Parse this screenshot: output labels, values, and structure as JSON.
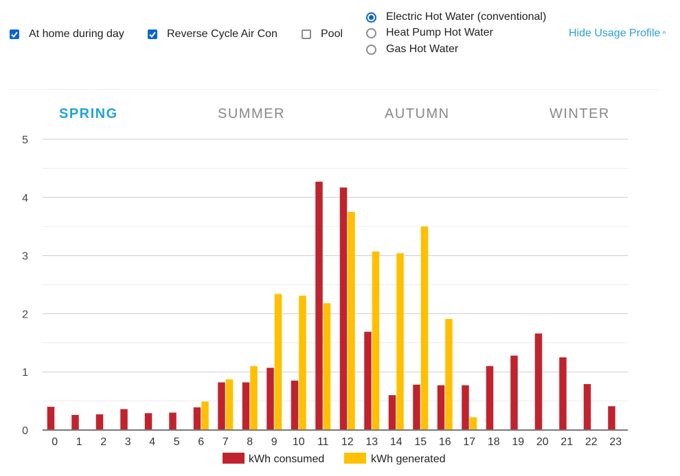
{
  "options": {
    "checkboxes": [
      {
        "label": "At home during day",
        "checked": true
      },
      {
        "label": "Reverse Cycle Air Con",
        "checked": true
      },
      {
        "label": "Pool",
        "checked": false
      }
    ],
    "hot_water": [
      {
        "label": "Electric Hot Water (conventional)",
        "selected": true
      },
      {
        "label": "Heat Pump Hot Water",
        "selected": false
      },
      {
        "label": "Gas Hot Water",
        "selected": false
      }
    ],
    "hide_link": "Hide Usage Profile",
    "hide_caret": "^"
  },
  "tabs": [
    {
      "label": "SPRING",
      "active": true
    },
    {
      "label": "SUMMER",
      "active": false
    },
    {
      "label": "AUTUMN",
      "active": false
    },
    {
      "label": "WINTER",
      "active": false
    }
  ],
  "colors": {
    "consumed": "#c1232e",
    "generated": "#ffc000",
    "accent": "#21a3d9",
    "checkbox": "#0b63d6"
  },
  "chart_data": {
    "type": "bar",
    "title": "",
    "xlabel": "",
    "ylabel": "",
    "ylim": [
      0,
      5
    ],
    "yticks": [
      0,
      1,
      2,
      3,
      4,
      5
    ],
    "grid": true,
    "legend": "bottom",
    "categories": [
      "0",
      "1",
      "2",
      "3",
      "4",
      "5",
      "6",
      "7",
      "8",
      "9",
      "10",
      "11",
      "12",
      "13",
      "14",
      "15",
      "16",
      "17",
      "18",
      "19",
      "20",
      "21",
      "22",
      "23"
    ],
    "series": [
      {
        "name": "kWh consumed",
        "values": [
          0.4,
          0.26,
          0.27,
          0.36,
          0.29,
          0.3,
          0.39,
          0.82,
          0.82,
          1.07,
          0.85,
          4.27,
          4.17,
          1.69,
          0.6,
          0.78,
          0.77,
          0.77,
          1.1,
          1.28,
          1.66,
          1.25,
          0.79,
          0.41
        ]
      },
      {
        "name": "kWh generated",
        "values": [
          0,
          0,
          0,
          0,
          0,
          0,
          0.49,
          0.87,
          1.1,
          2.34,
          2.31,
          2.18,
          3.75,
          3.07,
          3.04,
          3.5,
          1.91,
          0.22,
          0,
          0,
          0,
          0,
          0,
          0
        ]
      }
    ]
  }
}
